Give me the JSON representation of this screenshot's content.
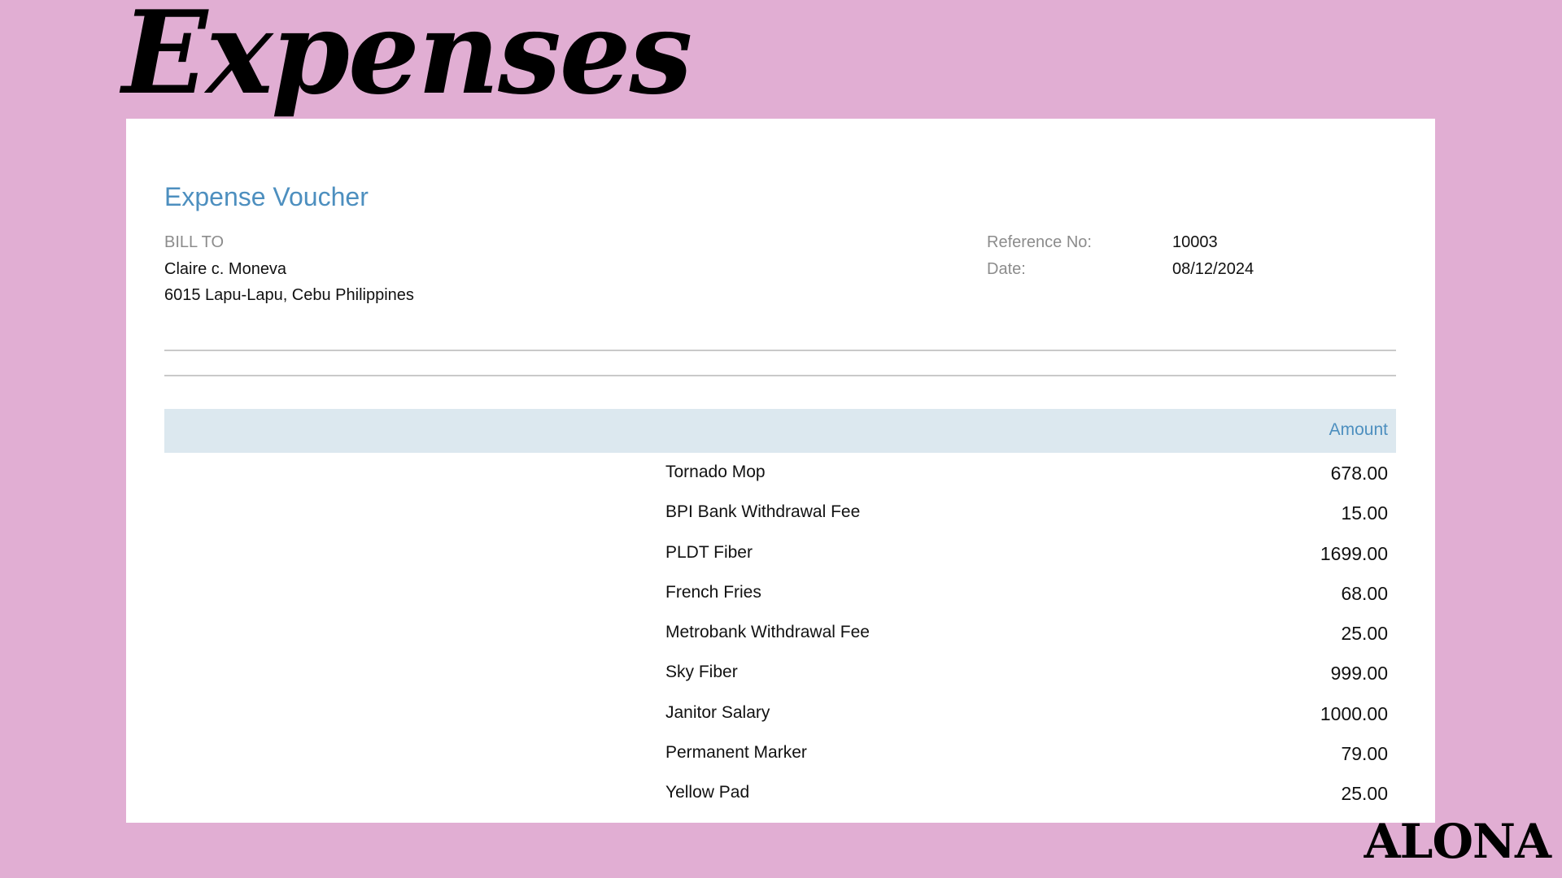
{
  "slide": {
    "title": "Expenses",
    "brand": "ALONA"
  },
  "voucher": {
    "title": "Expense Voucher",
    "bill_to_label": "BILL TO",
    "bill_to_name": "Claire c. Moneva",
    "bill_to_address": "6015 Lapu-Lapu, Cebu Philippines",
    "reference_label": "Reference No:",
    "reference_value": "10003",
    "date_label": "Date:",
    "date_value": "08/12/2024",
    "amount_header": "Amount",
    "items": [
      {
        "description": "Tornado Mop",
        "amount": "678.00"
      },
      {
        "description": "BPI Bank Withdrawal Fee",
        "amount": "15.00"
      },
      {
        "description": "PLDT Fiber",
        "amount": "1699.00"
      },
      {
        "description": "French Fries",
        "amount": "68.00"
      },
      {
        "description": "Metrobank Withdrawal Fee",
        "amount": "25.00"
      },
      {
        "description": "Sky Fiber",
        "amount": "999.00"
      },
      {
        "description": "Janitor Salary",
        "amount": "1000.00"
      },
      {
        "description": "Permanent Marker",
        "amount": "79.00"
      },
      {
        "description": "Yellow Pad",
        "amount": "25.00"
      }
    ]
  },
  "colors": {
    "background": "#e1aed3",
    "accent_blue": "#4d8fbf",
    "table_header_bg": "#dce8ef"
  }
}
